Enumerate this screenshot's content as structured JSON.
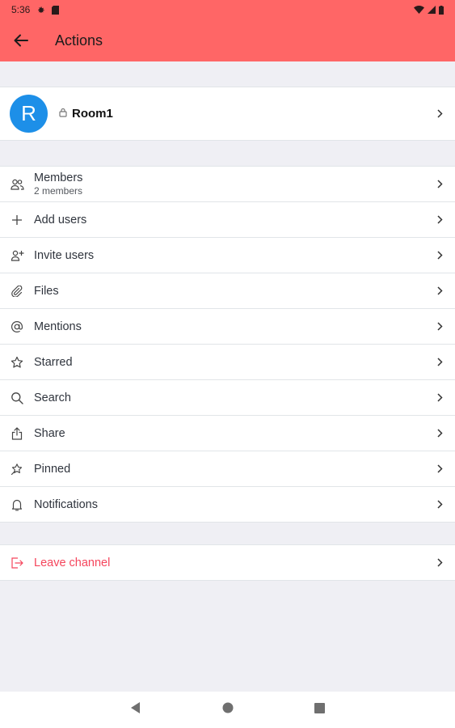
{
  "status_bar": {
    "time": "5:36"
  },
  "app_bar": {
    "title": "Actions"
  },
  "room": {
    "avatar_letter": "R",
    "name": "Room1"
  },
  "actions": [
    {
      "key": "members",
      "label": "Members",
      "sublabel": "2 members",
      "icon": "members-icon"
    },
    {
      "key": "add-users",
      "label": "Add users",
      "icon": "plus-icon"
    },
    {
      "key": "invite-users",
      "label": "Invite users",
      "icon": "invite-user-icon"
    },
    {
      "key": "files",
      "label": "Files",
      "icon": "paperclip-icon"
    },
    {
      "key": "mentions",
      "label": "Mentions",
      "icon": "at-icon"
    },
    {
      "key": "starred",
      "label": "Starred",
      "icon": "star-icon"
    },
    {
      "key": "search",
      "label": "Search",
      "icon": "search-icon"
    },
    {
      "key": "share",
      "label": "Share",
      "icon": "share-icon"
    },
    {
      "key": "pinned",
      "label": "Pinned",
      "icon": "pin-icon"
    },
    {
      "key": "notifications",
      "label": "Notifications",
      "icon": "bell-icon"
    }
  ],
  "leave": {
    "label": "Leave channel",
    "icon": "logout-icon"
  },
  "colors": {
    "accent": "#ff6666",
    "avatar": "#1d8fe8",
    "danger": "#f5455c"
  }
}
